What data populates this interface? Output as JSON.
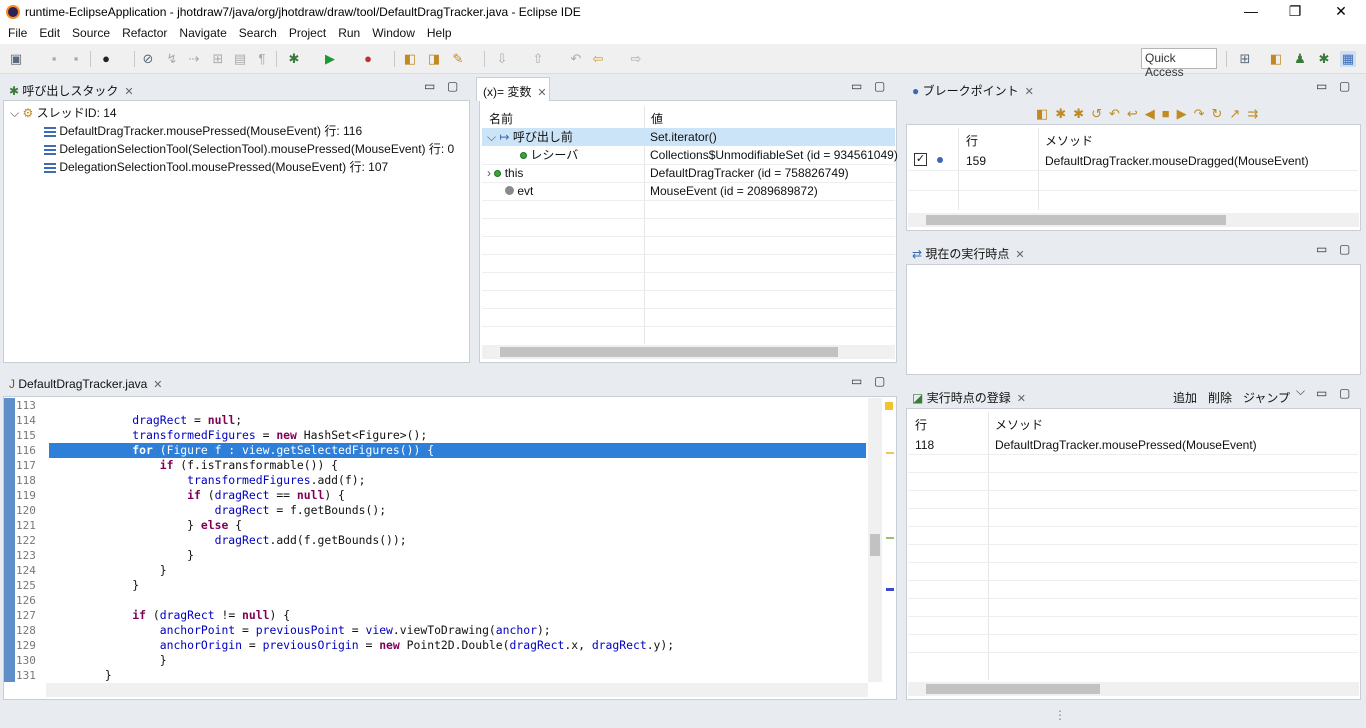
{
  "window": {
    "title": "runtime-EclipseApplication - jhotdraw7/java/org/jhotdraw/draw/tool/DefaultDragTracker.java - Eclipse IDE",
    "min": "—",
    "max": "❐",
    "close": "✕"
  },
  "menu": [
    "File",
    "Edit",
    "Source",
    "Refactor",
    "Navigate",
    "Search",
    "Project",
    "Run",
    "Window",
    "Help"
  ],
  "quick_access": "Quick Access",
  "callstack": {
    "tab": "呼び出しスタック",
    "thread": "スレッドID: 14",
    "frames": [
      "DefaultDragTracker.mousePressed(MouseEvent) 行: 116",
      "DelegationSelectionTool(SelectionTool).mousePressed(MouseEvent) 行: 0",
      "DelegationSelectionTool.mousePressed(MouseEvent) 行: 107"
    ]
  },
  "variables": {
    "tab": "変数",
    "tab_prefix": "(x)=",
    "col_name": "名前",
    "col_value": "値",
    "rows": [
      {
        "name": "呼び出し前",
        "value": "Set.iterator()"
      },
      {
        "name": "レシーバ",
        "value": "Collections$UnmodifiableSet (id = 934561049)"
      },
      {
        "name": "this",
        "value": "DefaultDragTracker (id = 758826749)"
      },
      {
        "name": "evt",
        "value": "MouseEvent (id = 2089689872)"
      }
    ]
  },
  "breakpoints": {
    "tab": "ブレークポイント",
    "col_line": "行",
    "col_method": "メソッド",
    "rows": [
      {
        "line": "159",
        "method": "DefaultDragTracker.mouseDragged(MouseEvent)"
      }
    ]
  },
  "current_exec": {
    "tab": "現在の実行時点"
  },
  "exec_register": {
    "tab": "実行時点の登録",
    "add": "追加",
    "delete": "削除",
    "jump": "ジャンプ",
    "col_line": "行",
    "col_method": "メソッド",
    "rows": [
      {
        "line": "118",
        "method": "DefaultDragTracker.mousePressed(MouseEvent)"
      }
    ]
  },
  "editor": {
    "tab": "DefaultDragTracker.java",
    "lines": [
      {
        "n": "113",
        "code": ""
      },
      {
        "n": "114",
        "code": "            dragRect = null;"
      },
      {
        "n": "115",
        "code": "            transformedFigures = new HashSet<Figure>();"
      },
      {
        "n": "116",
        "code": "            for (Figure f : view.getSelectedFigures()) {"
      },
      {
        "n": "117",
        "code": "                if (f.isTransformable()) {"
      },
      {
        "n": "118",
        "code": "                    transformedFigures.add(f);"
      },
      {
        "n": "119",
        "code": "                    if (dragRect == null) {"
      },
      {
        "n": "120",
        "code": "                        dragRect = f.getBounds();"
      },
      {
        "n": "121",
        "code": "                    } else {"
      },
      {
        "n": "122",
        "code": "                        dragRect.add(f.getBounds());"
      },
      {
        "n": "123",
        "code": "                    }"
      },
      {
        "n": "124",
        "code": "                }"
      },
      {
        "n": "125",
        "code": "            }"
      },
      {
        "n": "126",
        "code": ""
      },
      {
        "n": "127",
        "code": "            if (dragRect != null) {"
      },
      {
        "n": "128",
        "code": "                anchorPoint = previousPoint = view.viewToDrawing(anchor);"
      },
      {
        "n": "129",
        "code": "                anchorOrigin = previousOrigin = new Point2D.Double(dragRect.x, dragRect.y);"
      },
      {
        "n": "130",
        "code": "                }"
      },
      {
        "n": "131",
        "code": "        }"
      }
    ],
    "highlight": "116"
  }
}
